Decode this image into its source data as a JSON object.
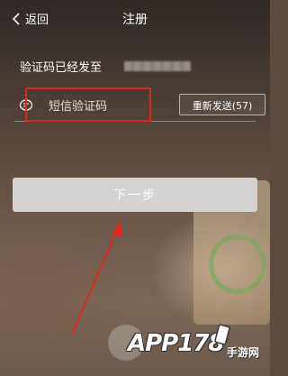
{
  "header": {
    "back_label": "返回",
    "title": "注册"
  },
  "form": {
    "sent_label": "验证码已经发至",
    "code_placeholder": "短信验证码",
    "resend_label": "重新发送(57)",
    "next_label": "下一步"
  },
  "watermark": {
    "brand": "APP178",
    "sub": "手游网"
  },
  "colors": {
    "highlight": "#e0261f",
    "button_bg": "#d5d3d1"
  }
}
